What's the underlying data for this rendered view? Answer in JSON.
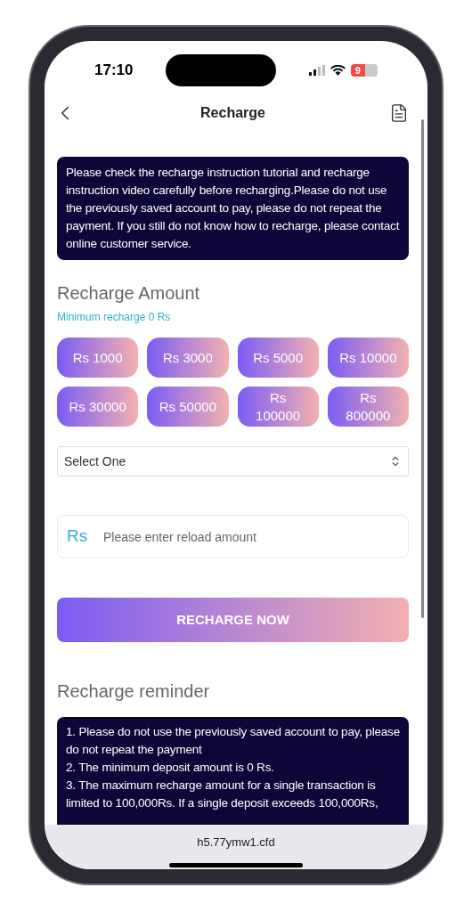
{
  "status_bar": {
    "time": "17:10",
    "battery": "9"
  },
  "header": {
    "title": "Recharge"
  },
  "notice": "Please check the recharge instruction tutorial and recharge instruction video carefully before recharging.Please do not use the previously saved account to pay, please do not repeat the payment. If you still do not know how to recharge, please contact online customer service.",
  "amount_section": {
    "title": "Recharge Amount",
    "subtitle": "Minimum recharge 0 Rs",
    "amounts": [
      "Rs 1000",
      "Rs 3000",
      "Rs 5000",
      "Rs 10000",
      "Rs 30000",
      "Rs 50000",
      "Rs 100000",
      "Rs 800000"
    ]
  },
  "channel_select": {
    "value": "Select One"
  },
  "amount_input": {
    "prefix": "Rs",
    "placeholder": "Please enter reload amount"
  },
  "submit_button": "RECHARGE NOW",
  "reminder": {
    "title": "Recharge reminder",
    "lines": [
      "1. Please do not use the previously saved account to pay, please do not repeat the payment",
      "2. The minimum deposit amount is 0 Rs.",
      "3. The maximum recharge amount for a single transaction is limited to 100,000Rs. If a single deposit exceeds 100,000Rs,"
    ]
  },
  "address_bar": {
    "url": "h5.77ymw1.cfd"
  }
}
